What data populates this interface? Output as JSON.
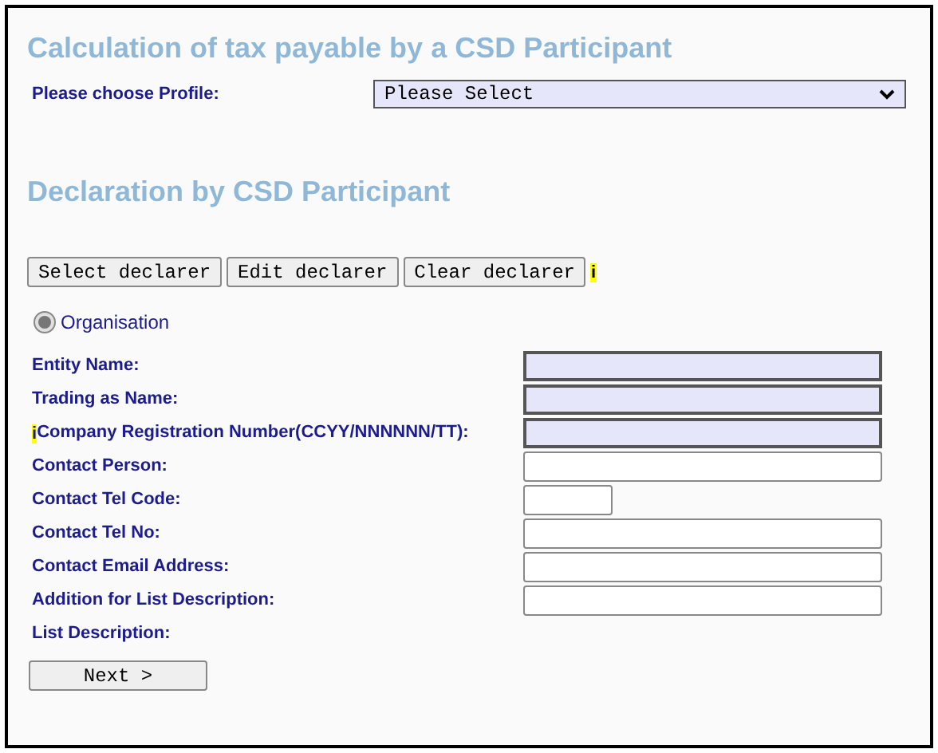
{
  "title": "Calculation of tax payable by a CSD Participant",
  "profile": {
    "label": "Please choose Profile:",
    "value": "Please Select"
  },
  "section_title": "Declaration by CSD Participant",
  "declarer_buttons": [
    "Select declarer",
    "Edit declarer",
    "Clear declarer"
  ],
  "declarer_info": "i",
  "organisation": {
    "label": "Organisation",
    "selected": true
  },
  "fields": [
    {
      "label": "Entity Name:",
      "kind": "required"
    },
    {
      "label": "Trading as Name:",
      "kind": "required"
    },
    {
      "label": "Company Registration Number(CCYY/NNNNNN/TT):",
      "info": "i",
      "kind": "required"
    },
    {
      "label": "Contact Person:",
      "kind": "plain"
    },
    {
      "label": "Contact Tel Code:",
      "kind": "short"
    },
    {
      "label": "Contact Tel No:",
      "kind": "plain"
    },
    {
      "label": "Contact Email Address:",
      "kind": "plain"
    },
    {
      "label": "Addition for List Description:",
      "kind": "plain"
    },
    {
      "label": "List Description:",
      "kind": "none"
    }
  ],
  "next_button": "Next >"
}
